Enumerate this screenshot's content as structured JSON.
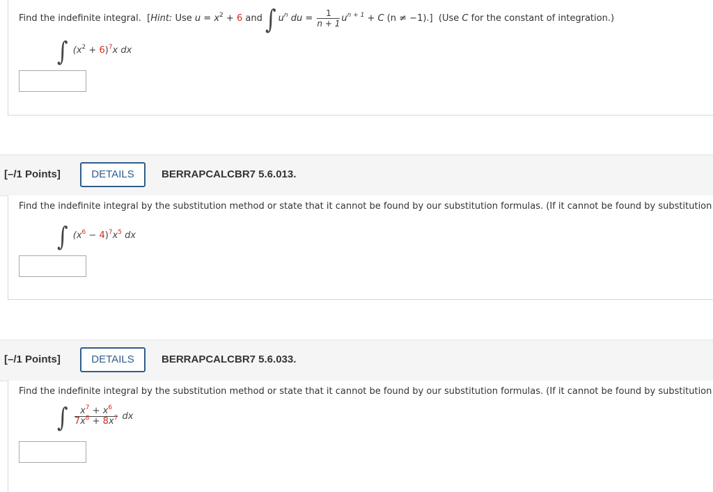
{
  "q1": {
    "prompt_lead": "Find the indefinite integral.",
    "hint_open": "[",
    "hint_label": "Hint:",
    "hint_use": "Use",
    "u_var": "u",
    "equals": "=",
    "x_var": "x",
    "exp2": "2",
    "plus": "+",
    "six": "6",
    "and": "and",
    "un": "u",
    "n": "n",
    "du": "du",
    "frac_num": "1",
    "frac_den": "n + 1",
    "u_after": "u",
    "exp_n1": "n + 1",
    "tail": "+",
    "C": "C",
    "cond": "(n ≠ −1).]",
    "use_c_open": "(Use",
    "use_c_rest": "for the constant of integration.)",
    "integrand": {
      "open": "(x",
      "exp": "2",
      "plus": " + ",
      "const": "6",
      "close": ")",
      "power": "7",
      "tail": "x dx"
    },
    "answer_value": ""
  },
  "q2": {
    "points": "[–/1 Points]",
    "details_label": "DETAILS",
    "code": "BERRAPCALCBR7 5.6.013.",
    "prompt": "Find the indefinite integral by the substitution method or state that it cannot be found by our substitution formulas. (If it cannot be found by substitution",
    "integrand": {
      "open": "(x",
      "exp": "6",
      "minus": " − ",
      "const": "4",
      "close": ")",
      "power": "7",
      "x": "x",
      "xexp": "5",
      "tail": " dx"
    },
    "answer_value": ""
  },
  "q3": {
    "points": "[–/1 Points]",
    "details_label": "DETAILS",
    "code": "BERRAPCALCBR7 5.6.033.",
    "prompt": "Find the indefinite integral by the substitution method or state that it cannot be found by our substitution formulas. (If it cannot be found by substitution",
    "integrand": {
      "num_x1": "x",
      "num_e1": "7",
      "num_plus": " + ",
      "num_x2": "x",
      "num_e2": "6",
      "den_c1": "7",
      "den_x1": "x",
      "den_e1": "8",
      "den_plus": " + ",
      "den_c2": "8",
      "den_x2": "x",
      "den_e2": "7",
      "tail": "dx"
    },
    "answer_value": ""
  }
}
